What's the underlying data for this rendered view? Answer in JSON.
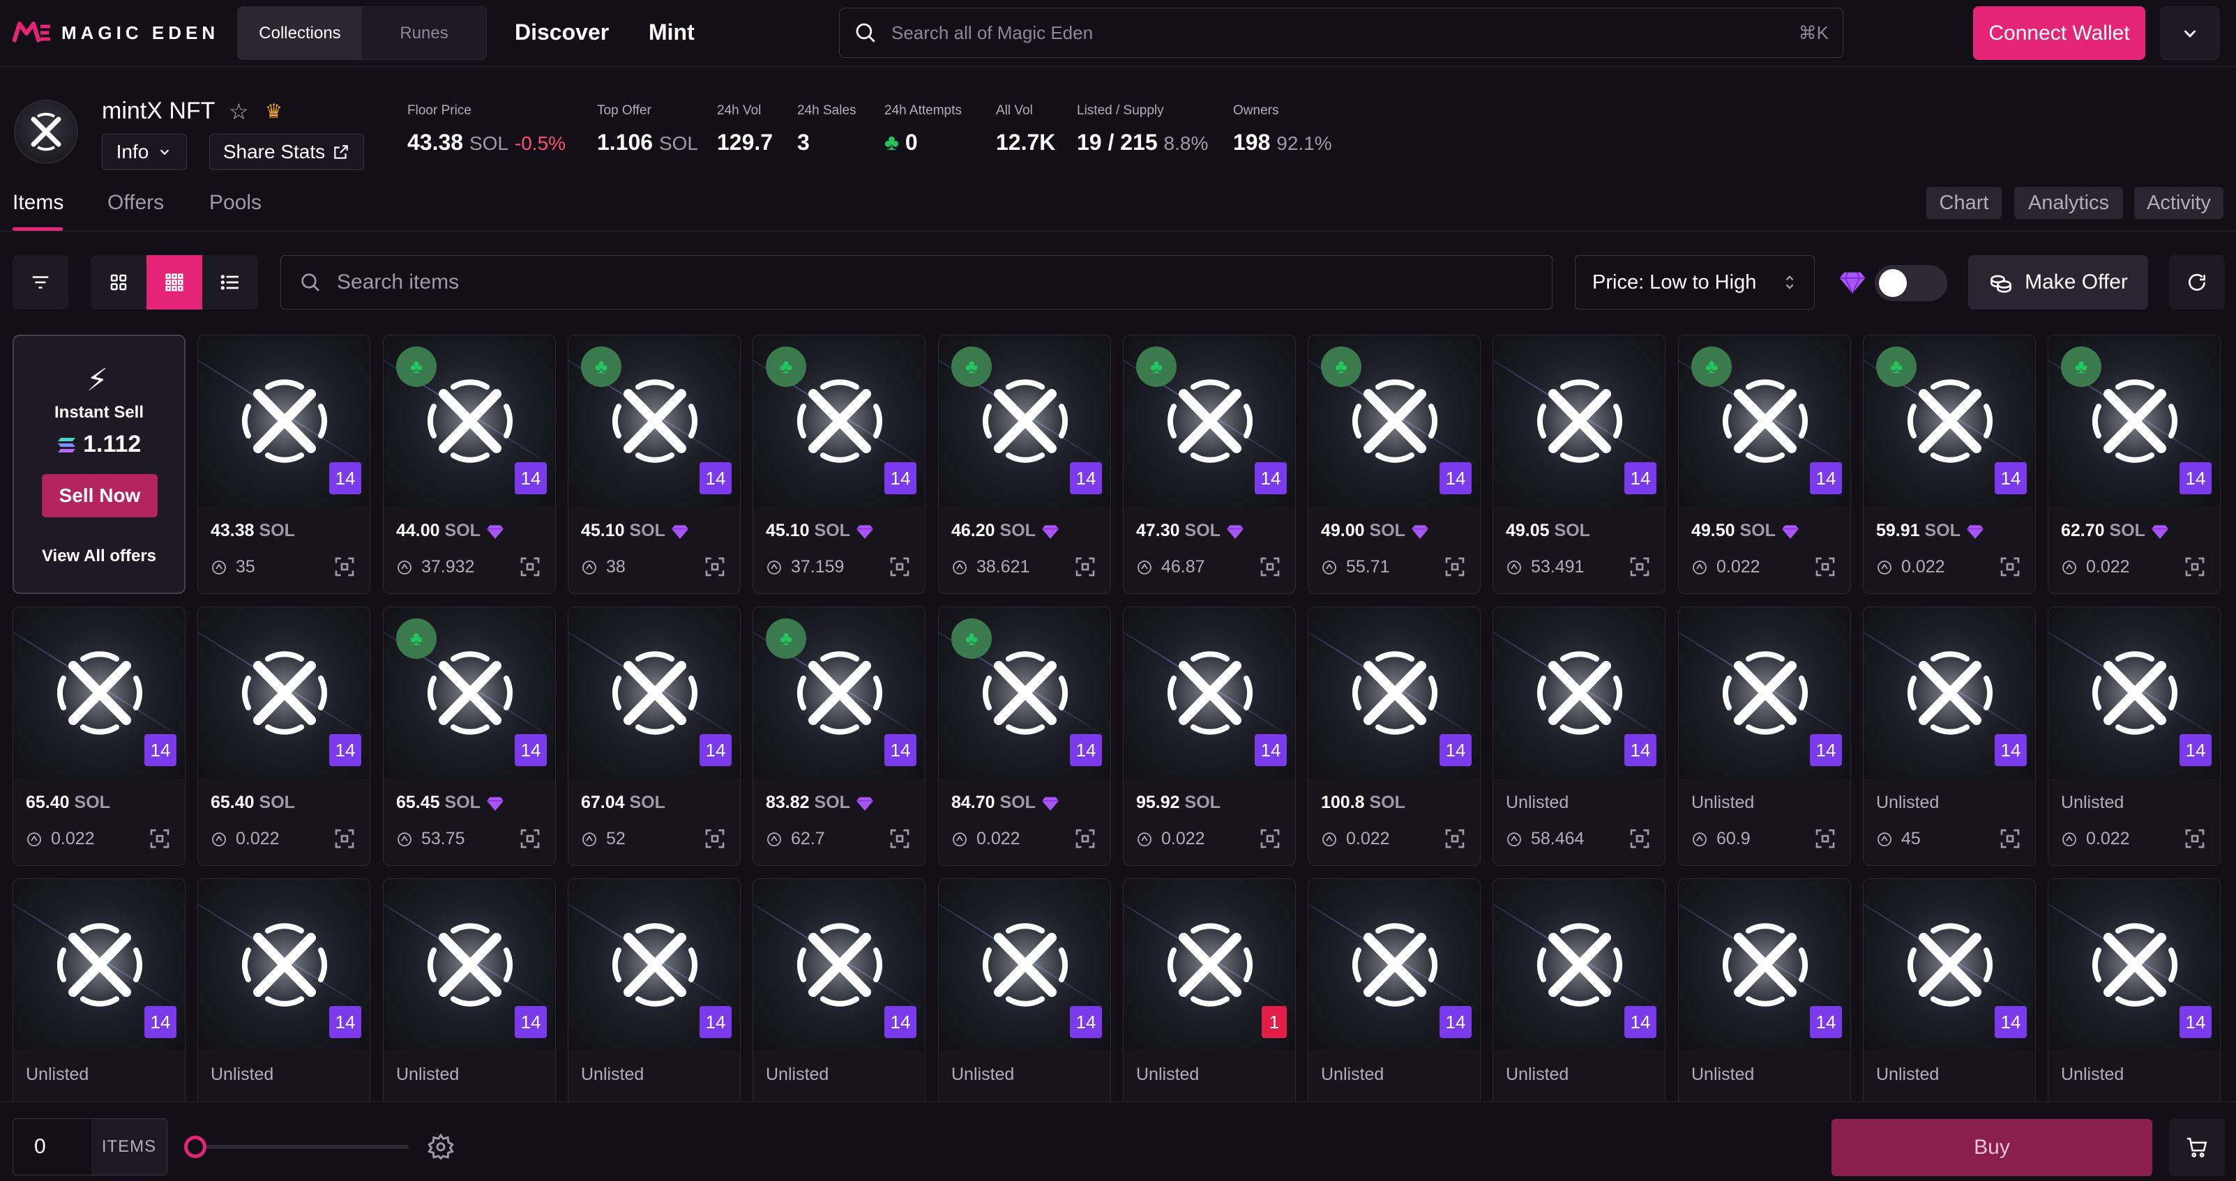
{
  "header": {
    "brand": "MAGIC EDEN",
    "segments": [
      "Collections",
      "Runes"
    ],
    "nav": [
      "Discover",
      "Mint"
    ],
    "search_placeholder": "Search all of Magic Eden",
    "search_shortcut": "⌘K",
    "connect_label": "Connect Wallet"
  },
  "collection": {
    "name": "mintX NFT",
    "info_label": "Info",
    "share_label": "Share Stats",
    "stats": [
      {
        "label": "Floor Price",
        "value": "43.38",
        "unit": "SOL",
        "change": "-0.5%"
      },
      {
        "label": "Top Offer",
        "value": "1.106",
        "unit": "SOL"
      },
      {
        "label": "24h Vol",
        "value": "129.7"
      },
      {
        "label": "24h Sales",
        "value": "3"
      },
      {
        "label": "24h Attempts",
        "value": "0"
      },
      {
        "label": "All Vol",
        "value": "12.7K"
      },
      {
        "label": "Listed / Supply",
        "value": "19 / 215",
        "pct": "8.8%"
      },
      {
        "label": "Owners",
        "value": "198",
        "pct": "92.1%"
      }
    ]
  },
  "tabs": [
    "Items",
    "Offers",
    "Pools"
  ],
  "right_tabs": [
    "Chart",
    "Analytics",
    "Activity"
  ],
  "toolbar": {
    "search_placeholder": "Search items",
    "sort_label": "Price: Low to High",
    "make_offer_label": "Make Offer"
  },
  "instant_sell": {
    "title": "Instant Sell",
    "amount": "1.112",
    "button": "Sell Now",
    "view_all": "View All offers"
  },
  "items": [
    {
      "price": "43.38",
      "unit": "SOL",
      "offer": "35",
      "rank": "14",
      "luck": false,
      "gem": false
    },
    {
      "price": "44.00",
      "unit": "SOL",
      "offer": "37.932",
      "rank": "14",
      "luck": true,
      "gem": true
    },
    {
      "price": "45.10",
      "unit": "SOL",
      "offer": "38",
      "rank": "14",
      "luck": true,
      "gem": true
    },
    {
      "price": "45.10",
      "unit": "SOL",
      "offer": "37.159",
      "rank": "14",
      "luck": true,
      "gem": true
    },
    {
      "price": "46.20",
      "unit": "SOL",
      "offer": "38.621",
      "rank": "14",
      "luck": true,
      "gem": true
    },
    {
      "price": "47.30",
      "unit": "SOL",
      "offer": "46.87",
      "rank": "14",
      "luck": true,
      "gem": true
    },
    {
      "price": "49.00",
      "unit": "SOL",
      "offer": "55.71",
      "rank": "14",
      "luck": true,
      "gem": true
    },
    {
      "price": "49.05",
      "unit": "SOL",
      "offer": "53.491",
      "rank": "14",
      "luck": false,
      "gem": false
    },
    {
      "price": "49.50",
      "unit": "SOL",
      "offer": "0.022",
      "rank": "14",
      "luck": true,
      "gem": true
    },
    {
      "price": "59.91",
      "unit": "SOL",
      "offer": "0.022",
      "rank": "14",
      "luck": true,
      "gem": true
    },
    {
      "price": "62.70",
      "unit": "SOL",
      "offer": "0.022",
      "rank": "14",
      "luck": true,
      "gem": true
    },
    {
      "price": "65.40",
      "unit": "SOL",
      "offer": "0.022",
      "rank": "14",
      "luck": false,
      "gem": false
    },
    {
      "price": "65.40",
      "unit": "SOL",
      "offer": "0.022",
      "rank": "14",
      "luck": false,
      "gem": false
    },
    {
      "price": "65.45",
      "unit": "SOL",
      "offer": "53.75",
      "rank": "14",
      "luck": true,
      "gem": true
    },
    {
      "price": "67.04",
      "unit": "SOL",
      "offer": "52",
      "rank": "14",
      "luck": false,
      "gem": false
    },
    {
      "price": "83.82",
      "unit": "SOL",
      "offer": "62.7",
      "rank": "14",
      "luck": true,
      "gem": true
    },
    {
      "price": "84.70",
      "unit": "SOL",
      "offer": "0.022",
      "rank": "14",
      "luck": true,
      "gem": true
    },
    {
      "price": "95.92",
      "unit": "SOL",
      "offer": "0.022",
      "rank": "14",
      "luck": false,
      "gem": false
    },
    {
      "price": "100.8",
      "unit": "SOL",
      "offer": "0.022",
      "rank": "14",
      "luck": false,
      "gem": false
    },
    {
      "price": "Unlisted",
      "unit": "",
      "offer": "58.464",
      "rank": "14",
      "luck": false,
      "gem": false
    },
    {
      "price": "Unlisted",
      "unit": "",
      "offer": "60.9",
      "rank": "14",
      "luck": false,
      "gem": false
    },
    {
      "price": "Unlisted",
      "unit": "",
      "offer": "45",
      "rank": "14",
      "luck": false,
      "gem": false
    },
    {
      "price": "Unlisted",
      "unit": "",
      "offer": "0.022",
      "rank": "14",
      "luck": false,
      "gem": false
    },
    {
      "price": "Unlisted",
      "unit": "",
      "offer": "",
      "rank": "14",
      "luck": false,
      "gem": false
    },
    {
      "price": "Unlisted",
      "unit": "",
      "offer": "",
      "rank": "14",
      "luck": false,
      "gem": false
    },
    {
      "price": "Unlisted",
      "unit": "",
      "offer": "",
      "rank": "14",
      "luck": false,
      "gem": false
    },
    {
      "price": "Unlisted",
      "unit": "",
      "offer": "",
      "rank": "14",
      "luck": false,
      "gem": false
    },
    {
      "price": "Unlisted",
      "unit": "",
      "offer": "",
      "rank": "14",
      "luck": false,
      "gem": false
    },
    {
      "price": "Unlisted",
      "unit": "",
      "offer": "",
      "rank": "14",
      "luck": false,
      "gem": false
    },
    {
      "price": "Unlisted",
      "unit": "",
      "offer": "",
      "rank": "1",
      "luck": false,
      "gem": false
    },
    {
      "price": "Unlisted",
      "unit": "",
      "offer": "",
      "rank": "14",
      "luck": false,
      "gem": false
    },
    {
      "price": "Unlisted",
      "unit": "",
      "offer": "",
      "rank": "14",
      "luck": false,
      "gem": false
    },
    {
      "price": "Unlisted",
      "unit": "",
      "offer": "",
      "rank": "14",
      "luck": false,
      "gem": false
    },
    {
      "price": "Unlisted",
      "unit": "",
      "offer": "",
      "rank": "14",
      "luck": false,
      "gem": false
    },
    {
      "price": "Unlisted",
      "unit": "",
      "offer": "",
      "rank": "14",
      "luck": false,
      "gem": false
    }
  ],
  "footer": {
    "qty_value": "0",
    "qty_label": "ITEMS",
    "buy_label": "Buy"
  },
  "colors": {
    "accent": "#e42575",
    "rank_badge": "#7c3aed",
    "luck_green": "#22c55e"
  }
}
